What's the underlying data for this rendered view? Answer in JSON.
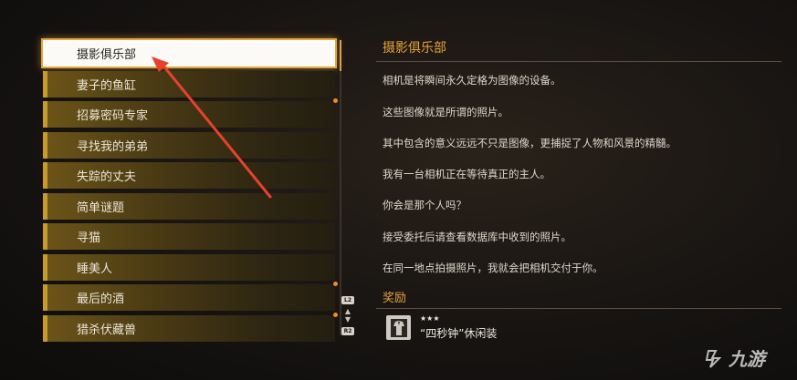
{
  "quest_list": {
    "items": [
      {
        "label": "摄影俱乐部",
        "selected": true,
        "has_dot": false
      },
      {
        "label": "妻子的鱼缸",
        "selected": false,
        "has_dot": false
      },
      {
        "label": "招募密码专家",
        "selected": false,
        "has_dot": true
      },
      {
        "label": "寻找我的弟弟",
        "selected": false,
        "has_dot": false
      },
      {
        "label": "失踪的丈夫",
        "selected": false,
        "has_dot": false
      },
      {
        "label": "简单谜题",
        "selected": false,
        "has_dot": false
      },
      {
        "label": "寻猫",
        "selected": false,
        "has_dot": false
      },
      {
        "label": "睡美人",
        "selected": false,
        "has_dot": false
      },
      {
        "label": "最后的酒",
        "selected": false,
        "has_dot": true
      },
      {
        "label": "猎杀伏藏兽",
        "selected": false,
        "has_dot": true
      }
    ]
  },
  "controller": {
    "l2": "L2",
    "r2": "R2",
    "arrows_icon": "up-down-arrows-icon"
  },
  "detail": {
    "title": "摄影俱乐部",
    "paragraphs": [
      "相机是将瞬间永久定格为图像的设备。",
      "这些图像就是所谓的照片。",
      "其中包含的意义远远不只是图像，更捕捉了人物和风景的精髓。",
      "我有一台相机正在等待真正的主人。",
      "你会是那个人吗？",
      "接受委托后请查看数据库中收到的照片。",
      "在同一地点拍摄照片，我就会把相机交付于你。"
    ]
  },
  "reward": {
    "heading": "奖励",
    "stars": "★★★",
    "name": "“四秒钟”休闲装",
    "icon": "outfit-icon"
  },
  "watermark": {
    "text": "九游",
    "icon": "jiuyou-logo-icon"
  },
  "colors": {
    "accent": "#e6a23c",
    "item_gold": "#c79a2a",
    "annotation_arrow": "#e8412c",
    "dot": "#f08a2a"
  }
}
